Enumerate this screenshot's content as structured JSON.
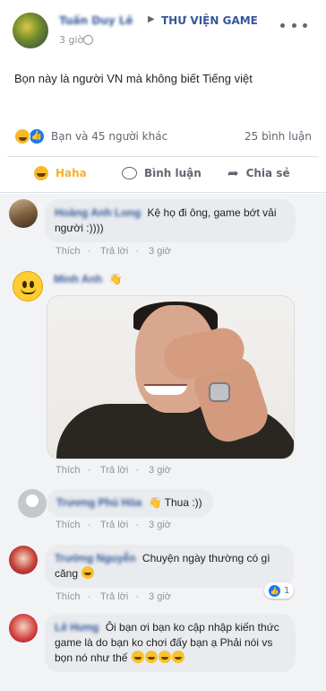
{
  "post": {
    "author": "Tuấn Duy Lê",
    "arrow": "▶",
    "group": "THƯ VIỆN GAME",
    "time": "3 giờ",
    "text": "Bọn này là người VN mà không biết Tiếng việt",
    "reactions_text": "Bạn và 45 người khác",
    "comments_count": "25 bình luận",
    "actions": {
      "haha": "Haha",
      "comment": "Bình luận",
      "share": "Chia sẻ"
    }
  },
  "comments": [
    {
      "name": "Hoàng Anh Long",
      "text": "Kệ họ đi ông, game bớt vải người :))))",
      "like": "Thích",
      "reply": "Trả lời",
      "time": "3 giờ"
    },
    {
      "name": "Minh Anh",
      "text": "👋",
      "like": "Thích",
      "reply": "Trả lời",
      "time": "3 giờ"
    },
    {
      "name": "Trương Phú Hòa",
      "text": "👋 Thua :))",
      "like": "Thích",
      "reply": "Trả lời",
      "time": "3 giờ"
    },
    {
      "name": "Trường Nguyễn",
      "text": "Chuyện ngày thường có gì căng",
      "like": "Thích",
      "reply": "Trả lời",
      "time": "3 giờ",
      "reaction_count": "1"
    },
    {
      "name": "Lê Hưng",
      "text": "Ôi bạn ơi bạn ko cập nhập kiến thức game là do bạn ko chơi   đấy bạn ạ Phải nói vs bọn nó như thế",
      "like": "",
      "reply": "",
      "time": ""
    }
  ],
  "icons": {
    "post_avatar": "avatar",
    "globe": "globe-icon",
    "menu": "more-options-icon",
    "haha": "haha-reaction-icon",
    "like": "like-reaction-icon",
    "comment": "comment-icon",
    "share": "share-icon"
  },
  "colors": {
    "link_blue": "#365899",
    "haha_yellow": "#f7b125",
    "like_blue": "#1877f2",
    "bubble_gray": "#e9ebee",
    "muted_text": "#90949c"
  }
}
